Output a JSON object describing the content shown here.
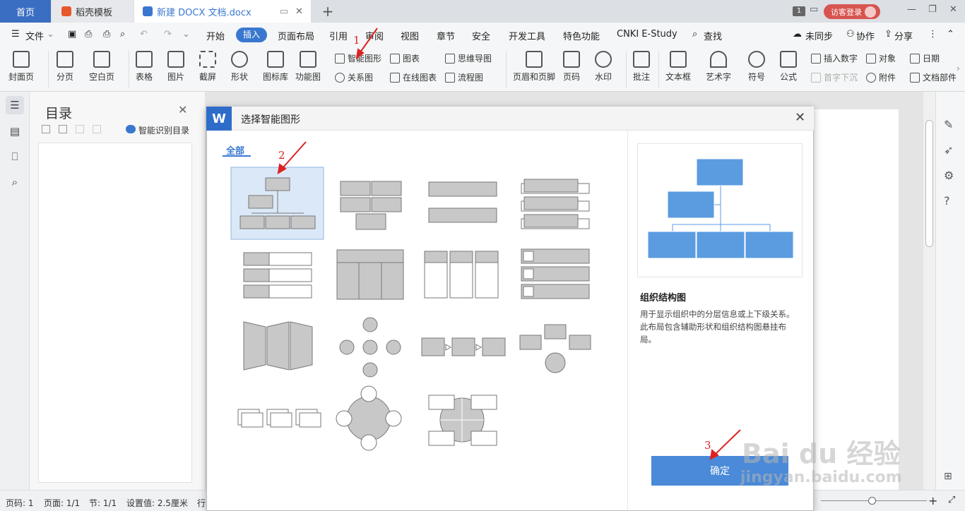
{
  "tabs": {
    "home": "首页",
    "template": "稻壳模板",
    "document": "新建 DOCX 文档.docx",
    "badge": "1",
    "visitor": "访客登录"
  },
  "menu": {
    "file": "文件",
    "items": [
      "开始",
      "插入",
      "页面布局",
      "引用",
      "审阅",
      "视图",
      "章节",
      "安全",
      "开发工具",
      "特色功能",
      "CNKI E-Study",
      "查找"
    ],
    "right": [
      "未同步",
      "协作",
      "分享"
    ]
  },
  "ribbon": {
    "cover": "封面页",
    "pagebreak": "分页",
    "blank": "空白页",
    "table": "表格",
    "picture": "图片",
    "screenshot": "截屏",
    "shape": "形状",
    "iconlib": "图标库",
    "funcchart": "功能图",
    "smartart": "智能图形",
    "relation": "关系图",
    "chart": "图表",
    "onlinechart": "在线图表",
    "mindmap": "思维导图",
    "flowchart": "流程图",
    "headerfooter": "页眉和页脚",
    "pagenum": "页码",
    "watermark": "水印",
    "comment": "批注",
    "textbox": "文本框",
    "wordart": "艺术字",
    "symbol": "符号",
    "formula": "公式",
    "insertnum": "插入数字",
    "dropcap": "首字下沉",
    "object": "对象",
    "attach": "附件",
    "date": "日期",
    "docpart": "文档部件"
  },
  "toc": {
    "title": "目录",
    "smart": "智能识别目录"
  },
  "dialog": {
    "title": "选择智能图形",
    "category": "全部",
    "preview_name": "组织结构图",
    "preview_desc": "用于显示组织中的分层信息或上下级关系。此布局包含辅助形状和组织结构图悬挂布局。",
    "ok": "确定"
  },
  "annotations": [
    "1",
    "2",
    "3"
  ],
  "status": {
    "page": "页码: 1",
    "pages": "页面: 1/1",
    "section": "节: 1/1",
    "setting": "设置值: 2.5厘米",
    "row": "行"
  },
  "watermark": {
    "logo": "Bai du 经验",
    "url": "jingyan.baidu.com"
  },
  "colors": {
    "accent": "#3a78d0",
    "tile_selected": "#dbe8f7",
    "shape_fill": "#c8c8c8",
    "preview_fill": "#5b9be0",
    "annotation": "#dd2222"
  }
}
